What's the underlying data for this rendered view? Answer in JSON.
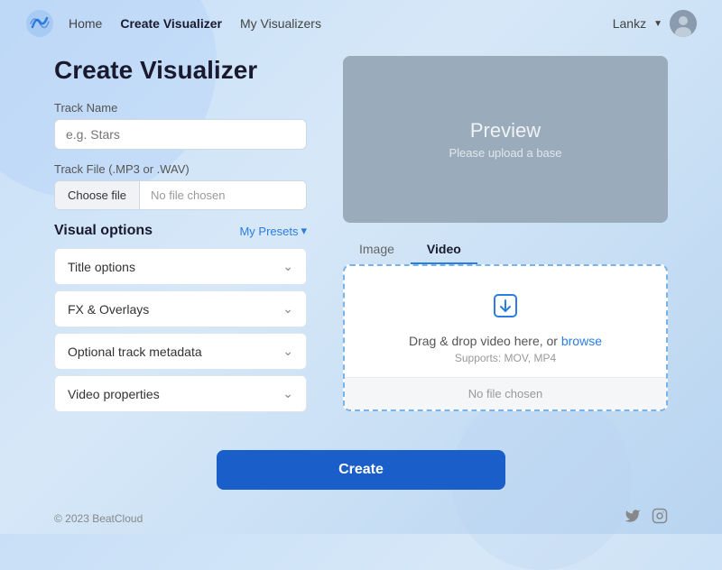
{
  "nav": {
    "home_label": "Home",
    "active_label": "Create Visualizer",
    "my_visualizers_label": "My Visualizers",
    "user_label": "Lankz"
  },
  "page": {
    "title": "Create Visualizer"
  },
  "form": {
    "track_name_label": "Track Name",
    "track_name_placeholder": "e.g. Stars",
    "track_file_label": "Track File (.MP3 or .WAV)",
    "choose_file_btn": "Choose file",
    "no_file_chosen": "No file chosen"
  },
  "visual_options": {
    "section_title": "Visual options",
    "presets_label": "My Presets",
    "accordion": [
      {
        "label": "Title options"
      },
      {
        "label": "FX & Overlays"
      },
      {
        "label": "Optional track metadata"
      },
      {
        "label": "Video properties"
      }
    ]
  },
  "preview": {
    "title": "Preview",
    "subtitle": "Please upload a base"
  },
  "media_tabs": [
    {
      "label": "Image",
      "active": false
    },
    {
      "label": "Video",
      "active": true
    }
  ],
  "dropzone": {
    "drag_text": "Drag & drop video here, or",
    "browse_text": "browse",
    "supports_text": "Supports: MOV, MP4",
    "no_file_label": "No file chosen"
  },
  "create_btn": "Create",
  "footer": {
    "copyright": "© 2023 BeatCloud"
  }
}
